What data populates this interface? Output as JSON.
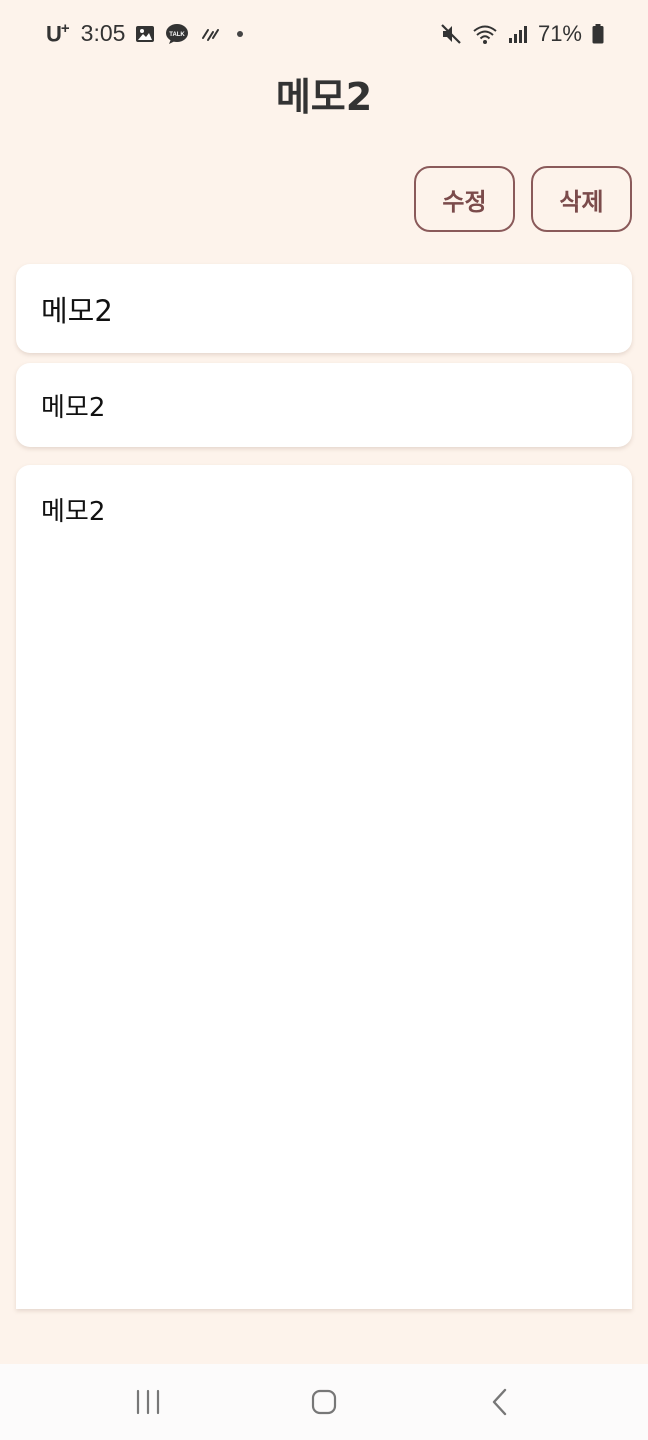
{
  "status_bar": {
    "carrier": "U",
    "carrier_plus": "+",
    "time": "3:05",
    "battery": "71%",
    "icons": [
      "gallery-icon",
      "talk-icon",
      "rain-icon",
      "mute-icon",
      "wifi-icon",
      "signal-icon",
      "battery-icon"
    ]
  },
  "header": {
    "title": "메모2"
  },
  "actions": {
    "edit_label": "수정",
    "delete_label": "삭제"
  },
  "memo": {
    "title": "메모2",
    "subtitle": "메모2",
    "body": "메모2"
  },
  "colors": {
    "background": "#fdf3eb",
    "button_border": "#8a5a5a",
    "button_text": "#7b4b4b"
  },
  "nav": {
    "icons": [
      "recents-icon",
      "home-icon",
      "back-icon"
    ]
  }
}
